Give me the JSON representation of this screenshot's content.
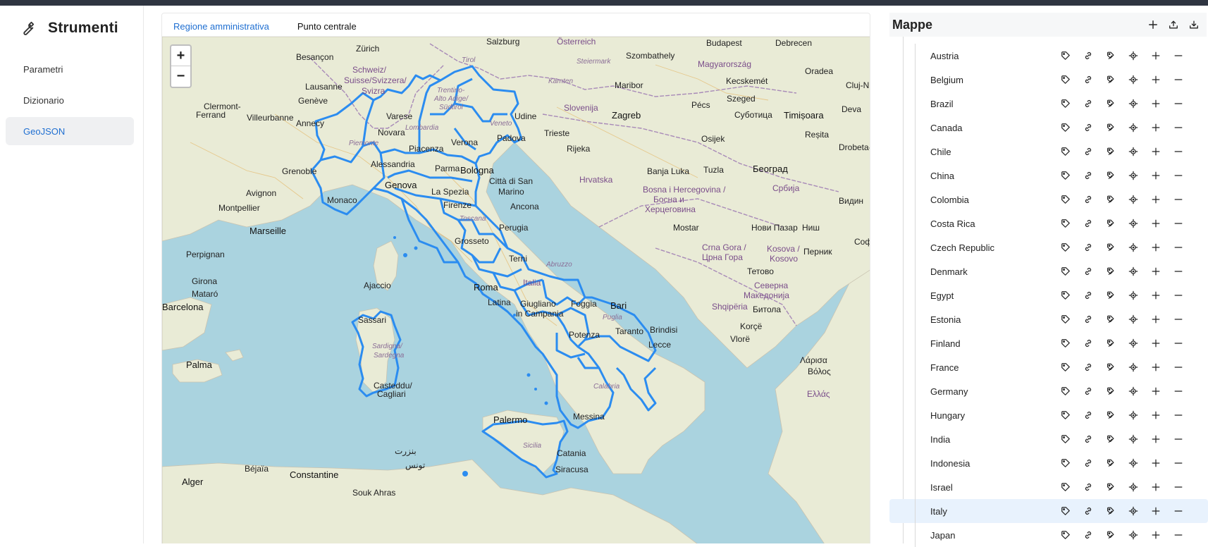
{
  "sidebar": {
    "title": "Strumenti",
    "items": [
      {
        "label": "Parametri",
        "active": false
      },
      {
        "label": "Dizionario",
        "active": false
      },
      {
        "label": "GeoJSON",
        "active": true
      }
    ]
  },
  "map_panel": {
    "tabs": [
      {
        "label": "Regione amministrativa",
        "active": true
      },
      {
        "label": "Punto centrale",
        "active": false
      }
    ],
    "zoom_in": "+",
    "zoom_out": "−",
    "labels": {
      "zurich": "Zürich",
      "salzburg": "Salzburg",
      "osterreich": "Österreich",
      "budapest": "Budapest",
      "debrecen": "Debrecen",
      "schweiz": "Schweiz/",
      "suisse": "Suisse/Svizzera/",
      "svizra": "Svizra",
      "tirol": "Tirol",
      "steiermark": "Steiermark",
      "magyarorszag": "Magyarország",
      "lausanne": "Lausanne",
      "geneve": "Genève",
      "trentino": "Trentino-",
      "altoadige": "Alto Adige/",
      "sudtirol": "Südtirol",
      "karnten": "Kärnten",
      "maribor": "Maribor",
      "kecskemet": "Kecskemét",
      "szeged": "Szeged",
      "slovenija": "Slovenija",
      "zagreb": "Zagreb",
      "pecs": "Pécs",
      "subotica": "Суботица",
      "timisoara": "Timișoara",
      "udine": "Udine",
      "trieste": "Trieste",
      "lyon": "Villeurbanne",
      "annecy": "Annecy",
      "varese": "Varese",
      "novara": "Novara",
      "lombardia": "Lombardia",
      "veneto": "Veneto",
      "padova": "Padova",
      "verona": "Verona",
      "osijek": "Osijek",
      "rijeka": "Rijeka",
      "piemonte": "Piemonte",
      "piacenza": "Piacenza",
      "grenoble": "Grenoble",
      "alessandria": "Alessandria",
      "parma": "Parma",
      "bologna": "Bologna",
      "cittadisan": "Città di San",
      "marino": "Marino",
      "hrvatska": "Hrvatska",
      "banjaluka": "Banja Luka",
      "tuzla": "Tuzla",
      "beograd": "Београд",
      "srbija": "Србија",
      "genova": "Genova",
      "laspezia": "La Spezia",
      "avignon": "Avignon",
      "montpellier": "Montpellier",
      "monaco": "Monaco",
      "firenze": "Firenze",
      "ancona": "Ancona",
      "bosna": "Bosna i Hercegovina /",
      "bosna2": "Босна и",
      "hercegovina": "Херцеговина",
      "marseille": "Marseille",
      "toscana": "Toscana",
      "perugia": "Perugia",
      "mostar": "Mostar",
      "novipazar": "Нови Пазар",
      "perpignan": "Perpignan",
      "grosseto": "Grosseto",
      "crnagora": "Crna Gora /",
      "crnagora2": "Црна Гора",
      "kosova": "Kosova /",
      "kosovo": "Kosovo",
      "abruzzo": "Abruzzo",
      "ajaccio": "Ajaccio",
      "roma": "Roma",
      "italia": "Italia",
      "bari": "Bari",
      "shqiperia": "Shqipëria",
      "severna": "Северна",
      "makedonija": "Македонија",
      "barcelona": "Barcelona",
      "sassari": "Sassari",
      "napoli": "Giugliano",
      "campania": "in Campania",
      "foggia": "Foggia",
      "latina": "Latina",
      "sardegna": "Sardigna/",
      "sardegna2": "Sardegna",
      "potenza": "Potenza",
      "taranto": "Taranto",
      "brindisi": "Brindisi",
      "lecce": "Lecce",
      "palma": "Palma",
      "vlore": "Vlorë",
      "larisa": "Λάρισα",
      "volos": "Βόλος",
      "cagliari": "Cagliari",
      "casteddu": "Casteddu/",
      "calabria": "Calabria",
      "ellas": "Ελλάς",
      "palermo": "Palermo",
      "messina": "Messina",
      "sicilia": "Sicilia",
      "catania": "Catania",
      "siracusa": "Siracusa",
      "bejaia": "Béjaïa",
      "constantine": "Constantine",
      "alger": "Alger",
      "tunis": "تونس",
      "soukahras": "Souk Ahras",
      "bizerte": "بنزرت",
      "puglia": "Puglia",
      "terni": "Terni",
      "aoste": "Clermont-",
      "ferrand": "Ferrand",
      "besancon": "Besançon",
      "cluj": "Cluj-N",
      "oradea": "Oradea",
      "deva": "Deva",
      "resita": "Reșita",
      "drobeta": "Drobeta-",
      "nis": "Ниш",
      "sofia": "Софи",
      "vidin": "Видин",
      "pernik": "Перник",
      "tetovo": "Тетово",
      "bitola": "Битола",
      "korce": "Korçë",
      "girona": "Girona",
      "mataro": "Mataró",
      "szombathely": "Szombathely"
    }
  },
  "maps_panel": {
    "title": "Mappe",
    "countries": [
      "Austria",
      "Belgium",
      "Brazil",
      "Canada",
      "Chile",
      "China",
      "Colombia",
      "Costa Rica",
      "Czech Republic",
      "Denmark",
      "Egypt",
      "Estonia",
      "Finland",
      "France",
      "Germany",
      "Hungary",
      "India",
      "Indonesia",
      "Israel",
      "Italy",
      "Japan"
    ],
    "selected": "Italy"
  },
  "colors": {
    "accent": "#1f6fd1",
    "region_stroke": "#2b8cf0",
    "sea": "#aad3df",
    "land": "#e9ebd6",
    "selected_row": "#e8f2fd",
    "topbar": "#2f3541"
  }
}
